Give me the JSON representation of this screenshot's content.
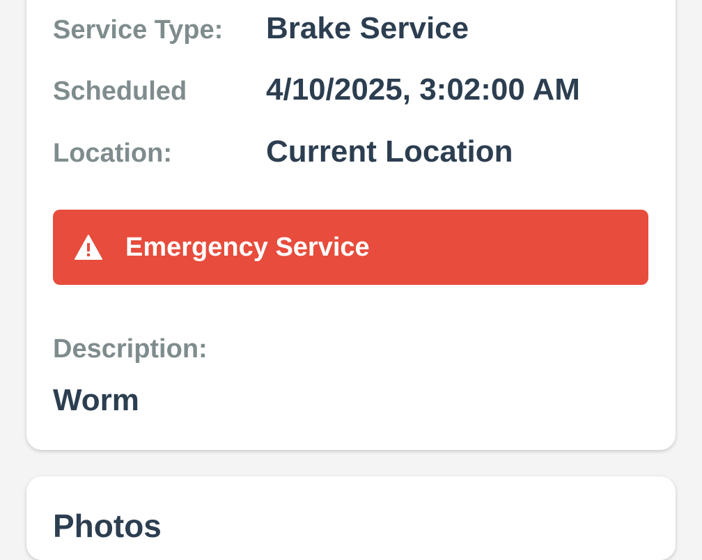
{
  "details": {
    "service_type": {
      "label": "Service Type:",
      "value": "Brake Service"
    },
    "scheduled": {
      "label": "Scheduled",
      "value": "4/10/2025, 3:02:00 AM"
    },
    "location": {
      "label": "Location:",
      "value": "Current Location"
    },
    "emergency_banner": {
      "icon": "warning-icon",
      "text": "Emergency Service",
      "color": "#e74c3c"
    },
    "description": {
      "label": "Description:",
      "value": "Worm"
    }
  },
  "photos": {
    "title": "Photos"
  },
  "colors": {
    "label": "#7f8c8d",
    "value": "#2c3e50",
    "background": "#f4f4f4",
    "card": "#ffffff"
  }
}
